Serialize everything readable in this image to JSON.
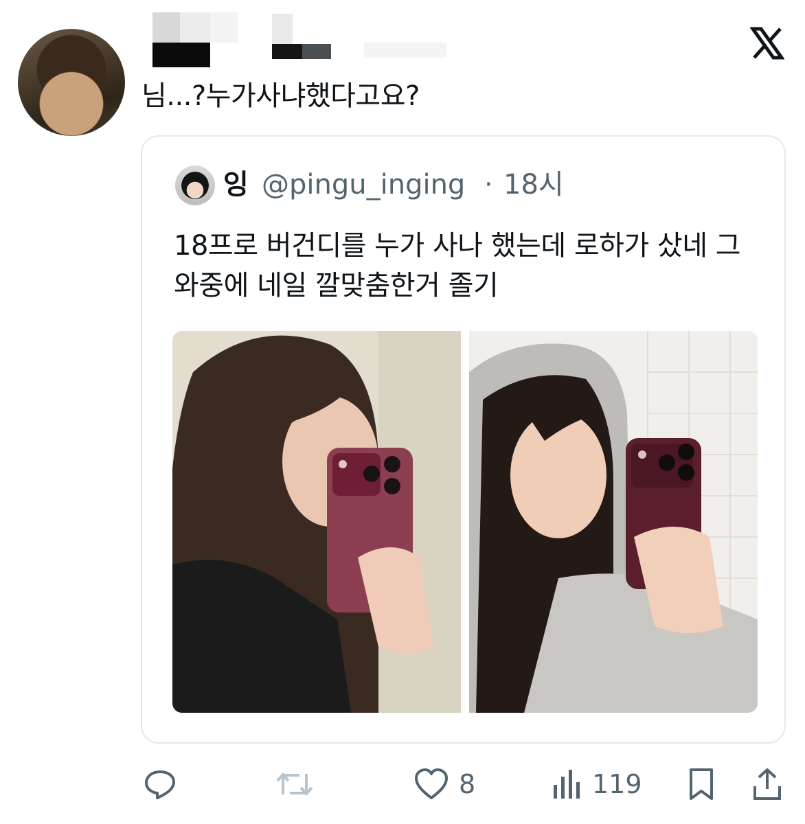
{
  "tweet": {
    "text": "님...?누가사냐했다고요?"
  },
  "quoted": {
    "name": "잉",
    "handle": "@pingu_inging",
    "separator": "·",
    "time": "18시",
    "text": "18프로 버건디를 누가 사나 했는데 로하가 샀네 그와중에 네일 깔맞춤한거 졸기"
  },
  "actions": {
    "likes": "8",
    "views": "119"
  },
  "icons": [
    "x-logo-icon",
    "reply-icon",
    "retweet-icon",
    "heart-icon",
    "views-icon",
    "bookmark-icon",
    "share-icon"
  ],
  "colors": {
    "text": "#0f1419",
    "secondary": "#536471",
    "border": "#e4e8eb",
    "retweet_disabled": "#b7c4cd"
  }
}
